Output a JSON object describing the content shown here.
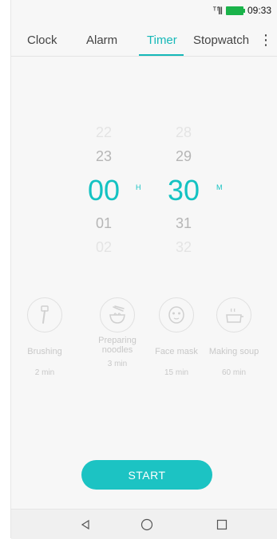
{
  "status": {
    "signal": "ᵀ ᶠ|||",
    "time": "09:33"
  },
  "tabs": [
    {
      "label": "Clock"
    },
    {
      "label": "Alarm"
    },
    {
      "label": "Timer"
    },
    {
      "label": "Stopwatch"
    }
  ],
  "picker": {
    "hours": [
      "22",
      "23",
      "00",
      "01",
      "02"
    ],
    "minutes": [
      "28",
      "29",
      "30",
      "31",
      "32"
    ],
    "hour_unit": "H",
    "minute_unit": "M"
  },
  "presets": [
    {
      "name": "Brushing",
      "duration": "2 min",
      "icon": "toothbrush-icon"
    },
    {
      "name": "Preparing noodles",
      "duration": "3 min",
      "icon": "noodle-bowl-icon"
    },
    {
      "name": "Face mask",
      "duration": "15 min",
      "icon": "face-mask-icon"
    },
    {
      "name": "Making soup",
      "duration": "60 min",
      "icon": "soup-pot-icon"
    }
  ],
  "start_label": "START",
  "colors": {
    "accent": "#16b8b8",
    "button": "#1cc3c3"
  }
}
